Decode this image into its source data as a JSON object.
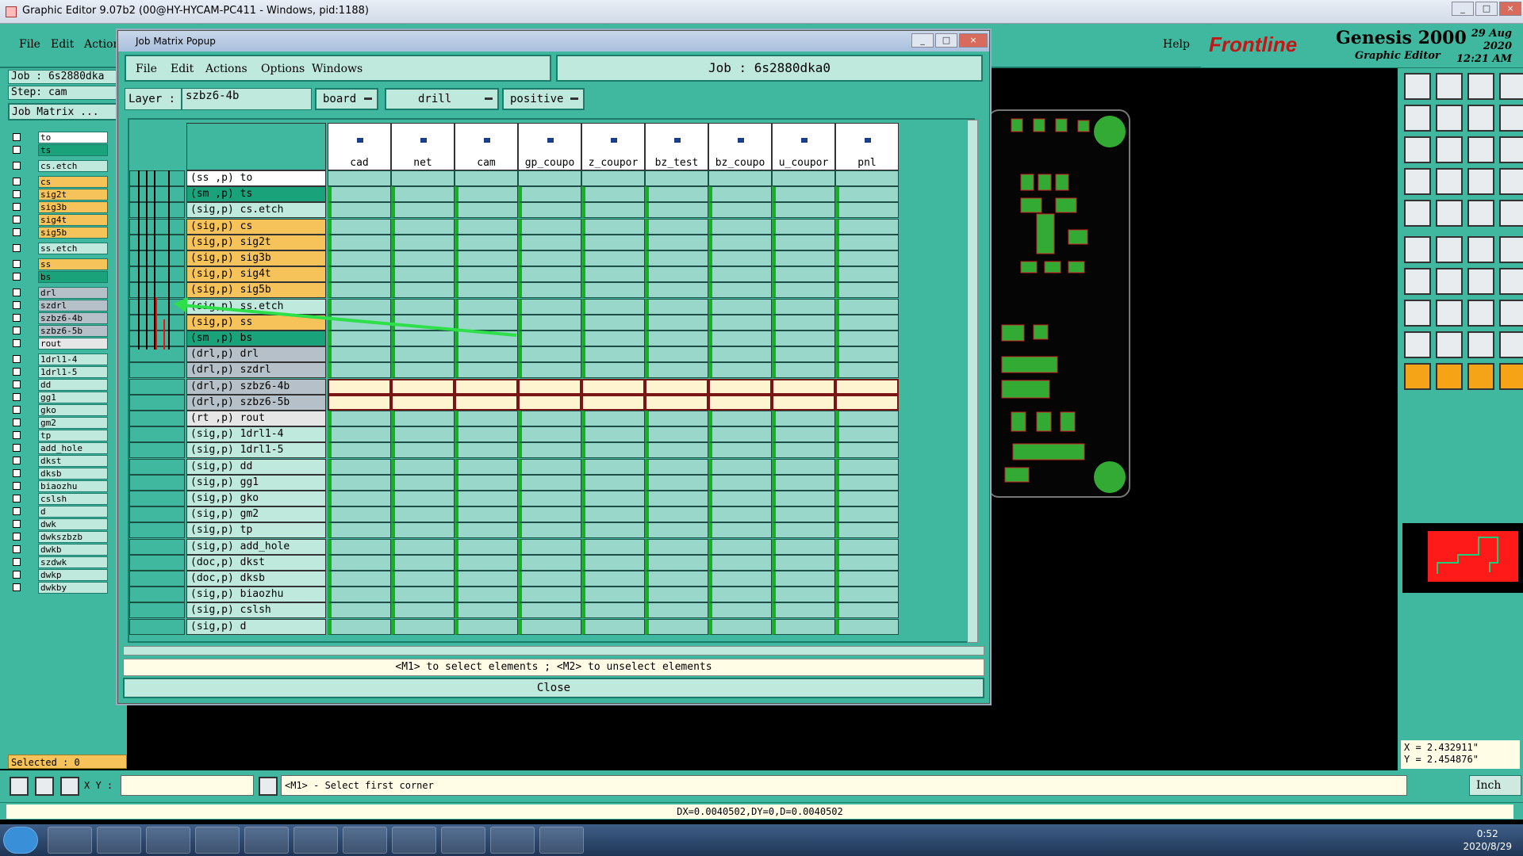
{
  "titlebar": {
    "title": "Graphic Editor 9.07b2 (00@HY-HYCAM-PC411 - Windows, pid:1188)"
  },
  "mainmenu": {
    "items": [
      "File",
      "Edit",
      "Action"
    ],
    "help": "Help"
  },
  "logo": {
    "brand": "Frontline",
    "product": "Genesis 2000",
    "subtitle": "Graphic Editor",
    "date": "29 Aug 2020",
    "time": "12:21 AM"
  },
  "leftpanel": {
    "job": "Job : 6s2880dka",
    "step": "Step: cam",
    "matrix_btn": "Job Matrix ...",
    "layers": [
      {
        "name": "to",
        "color": "#ffffff"
      },
      {
        "name": "ts",
        "color": "#1aa27a"
      },
      {
        "name": "cs.etch",
        "color": "#bfe9dd"
      },
      {
        "name": "cs",
        "color": "#f6c35a"
      },
      {
        "name": "sig2t",
        "color": "#f6c35a"
      },
      {
        "name": "sig3b",
        "color": "#f6c35a"
      },
      {
        "name": "sig4t",
        "color": "#f6c35a"
      },
      {
        "name": "sig5b",
        "color": "#f6c35a"
      },
      {
        "name": "ss.etch",
        "color": "#bfe9dd"
      },
      {
        "name": "ss",
        "color": "#f6c35a"
      },
      {
        "name": "bs",
        "color": "#1aa27a"
      },
      {
        "name": "drl",
        "color": "#b6c0c8"
      },
      {
        "name": "szdrl",
        "color": "#b6c0c8"
      },
      {
        "name": "szbz6-4b",
        "color": "#b6c0c8"
      },
      {
        "name": "szbz6-5b",
        "color": "#b6c0c8"
      },
      {
        "name": "rout",
        "color": "#e6e6e6"
      },
      {
        "name": "1drl1-4",
        "color": "#bfe9dd"
      },
      {
        "name": "1drl1-5",
        "color": "#bfe9dd"
      },
      {
        "name": "dd",
        "color": "#bfe9dd"
      },
      {
        "name": "gg1",
        "color": "#bfe9dd"
      },
      {
        "name": "gko",
        "color": "#bfe9dd"
      },
      {
        "name": "gm2",
        "color": "#bfe9dd"
      },
      {
        "name": "tp",
        "color": "#bfe9dd"
      },
      {
        "name": "add_hole",
        "color": "#bfe9dd"
      },
      {
        "name": "dkst",
        "color": "#bfe9dd"
      },
      {
        "name": "dksb",
        "color": "#bfe9dd"
      },
      {
        "name": "biaozhu",
        "color": "#bfe9dd"
      },
      {
        "name": "cslsh",
        "color": "#bfe9dd"
      },
      {
        "name": "d",
        "color": "#bfe9dd"
      },
      {
        "name": "dwk",
        "color": "#bfe9dd"
      },
      {
        "name": "dwkszbzb",
        "color": "#bfe9dd"
      },
      {
        "name": "dwkb",
        "color": "#bfe9dd"
      },
      {
        "name": "szdwk",
        "color": "#bfe9dd"
      },
      {
        "name": "dwkp",
        "color": "#bfe9dd"
      },
      {
        "name": "dwkby",
        "color": "#bfe9dd"
      }
    ],
    "selected": "Selected : 0"
  },
  "popup": {
    "title": "Job Matrix Popup",
    "menu": [
      "File",
      "Edit",
      "Actions",
      "Options",
      "Windows"
    ],
    "job": "Job : 6s2880dka0",
    "layer_label": "Layer :",
    "layer_value": "szbz6-4b",
    "dropdowns": [
      "board",
      "drill",
      "positive"
    ],
    "columns": [
      "cad",
      "net",
      "cam",
      "gp_coupo",
      "z_coupor",
      "bz_test",
      "bz_coupo",
      "u_coupor",
      "pnl"
    ],
    "rows": [
      {
        "label": "(ss ,p) to",
        "color": "#ffffff"
      },
      {
        "label": "(sm ,p) ts",
        "color": "#1aa27a"
      },
      {
        "label": "(sig,p) cs.etch",
        "color": "#bfe9dd"
      },
      {
        "label": "(sig,p) cs",
        "color": "#f6c35a"
      },
      {
        "label": "(sig,p) sig2t",
        "color": "#f6c35a"
      },
      {
        "label": "(sig,p) sig3b",
        "color": "#f6c35a"
      },
      {
        "label": "(sig,p) sig4t",
        "color": "#f6c35a"
      },
      {
        "label": "(sig,p) sig5b",
        "color": "#f6c35a"
      },
      {
        "label": "(sig,p) ss.etch",
        "color": "#bfe9dd"
      },
      {
        "label": "(sig,p) ss",
        "color": "#f6c35a"
      },
      {
        "label": "(sm ,p) bs",
        "color": "#1aa27a"
      },
      {
        "label": "(drl,p) drl",
        "color": "#b6c0c8"
      },
      {
        "label": "(drl,p) szdrl",
        "color": "#b6c0c8"
      },
      {
        "label": "(drl,p) szbz6-4b",
        "color": "#b6c0c8",
        "selected": true
      },
      {
        "label": "(drl,p) szbz6-5b",
        "color": "#b6c0c8",
        "selected": true
      },
      {
        "label": "(rt ,p) rout",
        "color": "#e6e6e6"
      },
      {
        "label": "(sig,p) 1drl1-4",
        "color": "#bfe9dd"
      },
      {
        "label": "(sig,p) 1drl1-5",
        "color": "#bfe9dd"
      },
      {
        "label": "(sig,p) dd",
        "color": "#bfe9dd"
      },
      {
        "label": "(sig,p) gg1",
        "color": "#bfe9dd"
      },
      {
        "label": "(sig,p) gko",
        "color": "#bfe9dd"
      },
      {
        "label": "(sig,p) gm2",
        "color": "#bfe9dd"
      },
      {
        "label": "(sig,p) tp",
        "color": "#bfe9dd"
      },
      {
        "label": "(sig,p) add_hole",
        "color": "#bfe9dd"
      },
      {
        "label": "(doc,p) dkst",
        "color": "#bfe9dd"
      },
      {
        "label": "(doc,p) dksb",
        "color": "#bfe9dd"
      },
      {
        "label": "(sig,p) biaozhu",
        "color": "#bfe9dd"
      },
      {
        "label": "(sig,p) cslsh",
        "color": "#bfe9dd"
      },
      {
        "label": "(sig,p) d",
        "color": "#bfe9dd"
      }
    ],
    "hint": "<M1> to select elements ; <M2> to unselect elements",
    "close": "Close"
  },
  "bottom": {
    "xy_label": "X Y :",
    "prompt": "<M1> - Select first corner",
    "unit": "Inch"
  },
  "status": "DX=0.0040502,DY=0,D=0.0040502",
  "coords": {
    "x": "X = 2.432911\"",
    "y": "Y = 2.454876\""
  },
  "taskbar": {
    "time": "0:52",
    "date": "2020/8/29"
  }
}
